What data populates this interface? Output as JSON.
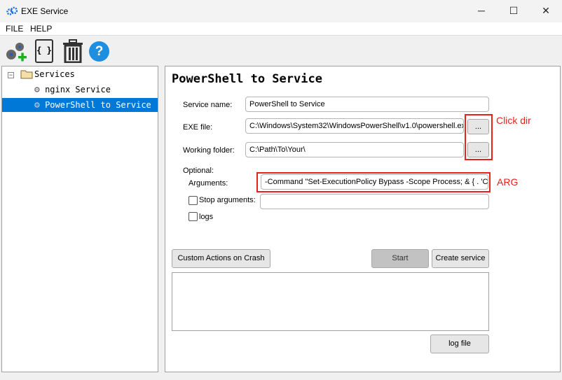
{
  "window": {
    "title": "EXE Service",
    "minimize": "─",
    "maximize": "☐",
    "close": "✕"
  },
  "menu": [
    "FILE",
    "HELP"
  ],
  "toolbar": {
    "icons": [
      "add-service-icon",
      "json-file-icon",
      "trash-icon",
      "help-icon"
    ],
    "help_glyph": "?",
    "json_glyph": "{ }"
  },
  "tree": {
    "root": "Services",
    "expander": "−",
    "items": [
      {
        "label": "nginx Service",
        "selected": false
      },
      {
        "label": "PowerShell to Service",
        "selected": true
      }
    ]
  },
  "form": {
    "title": "PowerShell to Service",
    "service_name_label": "Service name:",
    "service_name": "PowerShell to Service",
    "exe_label": "EXE file:",
    "exe": "C:\\Windows\\System32\\WindowsPowerShell\\v1.0\\powershell.ex",
    "workdir_label": "Working folder:",
    "workdir": "C:\\Path\\To\\Your\\",
    "browse": "...",
    "optional_label": "Optional:",
    "args_label": "Arguments:",
    "args": "-Command \"Set-ExecutionPolicy Bypass -Scope Process; & { . 'C:\\P",
    "stop_args_label": "Stop arguments:",
    "stop_args": "",
    "stop_args_checked": false,
    "logs_label": "logs",
    "logs_checked": false,
    "crash_button": "Custom Actions on Crash",
    "start_button": "Start",
    "create_button": "Create service",
    "log_output": "",
    "logfile_button": "log file"
  },
  "annotations": {
    "click_dir": "Click dir",
    "arg": "ARG",
    "color": "#e8211a"
  },
  "colors": {
    "selection": "#0078d7"
  }
}
